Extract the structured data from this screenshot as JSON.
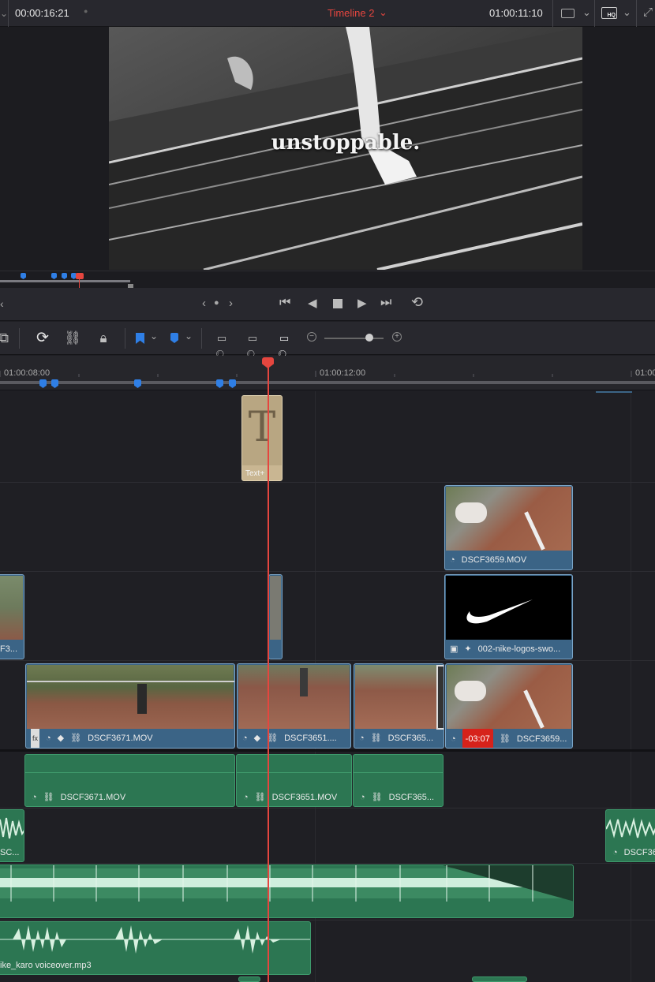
{
  "topbar": {
    "source_timecode": "00:00:16:21",
    "timeline_name": "Timeline 2",
    "record_timecode": "01:00:11:10"
  },
  "viewer": {
    "title_text": "unstoppable."
  },
  "ruler": {
    "labels": [
      "01:00:08:00",
      "01:00:12:00",
      "01:00"
    ]
  },
  "clips": {
    "title_clip": {
      "letter": "T",
      "label": "Text+"
    },
    "v3_right": "DSCF3659.MOV",
    "v2_left": "F3...",
    "v2_right": "002-nike-logos-swo...",
    "v1_a": "DSCF3671.MOV",
    "v1_b": "DSCF3651....",
    "v1_c": "DSCF365...",
    "v1_d": "DSCF3659...",
    "v1_d_badge": "-03:07",
    "a1_a": "DSCF3671.MOV",
    "a1_b": "DSCF3651.MOV",
    "a1_c": "DSCF365...",
    "a2_left": "SC...",
    "a2_right": "DSCF36",
    "a4": "ike_karo voiceover.mp3"
  },
  "colors": {
    "accent_red": "#e5463f",
    "video_clip": "#3b6486",
    "audio_clip": "#2c7652",
    "marker_blue": "#2f7fe6"
  },
  "icons": [
    "frame-size-icon",
    "chevron-down-icon",
    "hq-icon",
    "snap-icon",
    "link-icon",
    "lock-icon",
    "flag-icon",
    "marker-icon",
    "zoom-icon",
    "minus-icon",
    "plus-icon",
    "fx-icon",
    "speed-icon",
    "image-icon",
    "sparkle-icon"
  ]
}
